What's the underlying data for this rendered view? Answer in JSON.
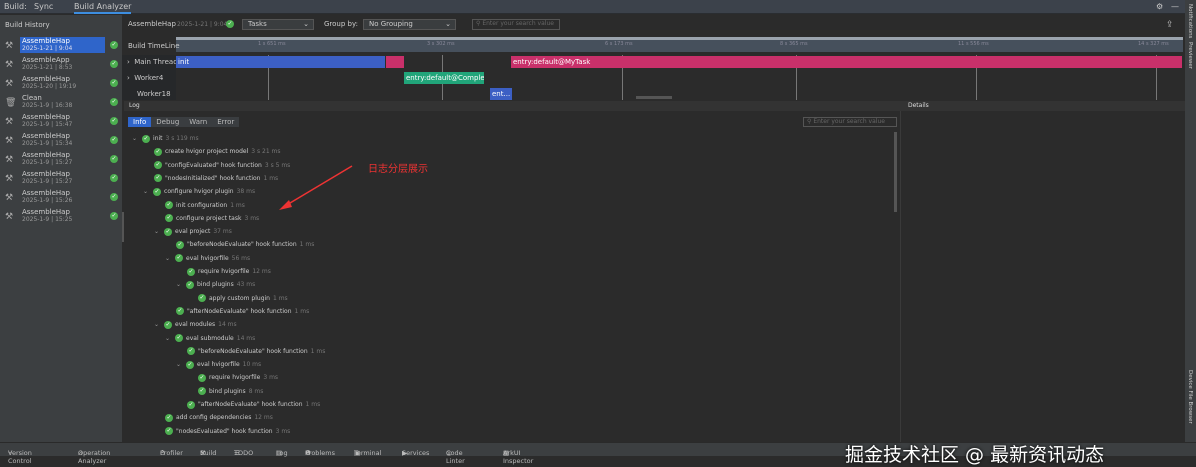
{
  "topbar": {
    "build": "Build:",
    "tabs": [
      "Sync",
      "Build Analyzer"
    ]
  },
  "history": {
    "title": "Build History",
    "items": [
      {
        "name": "AssembleHap",
        "date": "2025-1-21 | 9:04",
        "icon": "hammer-icon"
      },
      {
        "name": "AssembleApp",
        "date": "2025-1-21 | 8:53",
        "icon": "hammer-icon"
      },
      {
        "name": "AssembleHap",
        "date": "2025-1-20 | 19:19",
        "icon": "hammer-icon"
      },
      {
        "name": "Clean",
        "date": "2025-1-9 | 16:38",
        "icon": "trash-icon"
      },
      {
        "name": "AssembleHap",
        "date": "2025-1-9 | 15:47",
        "icon": "hammer-icon"
      },
      {
        "name": "AssembleHap",
        "date": "2025-1-9 | 15:34",
        "icon": "hammer-icon"
      },
      {
        "name": "AssembleHap",
        "date": "2025-1-9 | 15:27",
        "icon": "hammer-icon"
      },
      {
        "name": "AssembleHap",
        "date": "2025-1-9 | 15:27",
        "icon": "hammer-icon"
      },
      {
        "name": "AssembleHap",
        "date": "2025-1-9 | 15:26",
        "icon": "hammer-icon"
      },
      {
        "name": "AssembleHap",
        "date": "2025-1-9 | 15:25",
        "icon": "hammer-icon"
      }
    ]
  },
  "toolbar": {
    "task": "AssembleHap",
    "date": "2025-1-21 | 9:04",
    "view": "Tasks",
    "group_label": "Group by:",
    "group": "No Grouping",
    "search_placeholder": "Enter your search value"
  },
  "timeline": {
    "title": "Build TimeLine",
    "rows": [
      "Main Thread",
      "Worker4",
      "Worker18"
    ],
    "ticks": [
      "1 s 651 ms",
      "3 s 302 ms",
      "6 s 173 ms",
      "8 s 365 ms",
      "11 s 556 ms",
      "14 s 327 ms"
    ],
    "bars": {
      "init": "init",
      "mytask": "entry:default@MyTask",
      "compile": "entry:default@Comple...",
      "ent": "ent..."
    }
  },
  "log": {
    "title": "Log",
    "details": "Details",
    "levels": [
      "Info",
      "Debug",
      "Warn",
      "Error"
    ],
    "search_placeholder": "Enter your search value",
    "rows": [
      {
        "d": 0,
        "c": true,
        "t": "init",
        "tm": "3 s 119 ms"
      },
      {
        "d": 1,
        "c": false,
        "t": "create hvigor project model",
        "tm": "3 s 21 ms"
      },
      {
        "d": 1,
        "c": false,
        "t": "\"configEvaluated\" hook function",
        "tm": "3 s 5 ms"
      },
      {
        "d": 1,
        "c": false,
        "t": "\"nodesInitialized\" hook function",
        "tm": "1 ms"
      },
      {
        "d": 1,
        "c": true,
        "t": "configure hvigor plugin",
        "tm": "38 ms"
      },
      {
        "d": 2,
        "c": false,
        "t": "init configuration",
        "tm": "1 ms"
      },
      {
        "d": 2,
        "c": false,
        "t": "configure project task",
        "tm": "3 ms"
      },
      {
        "d": 2,
        "c": true,
        "t": "eval project",
        "tm": "37 ms"
      },
      {
        "d": 3,
        "c": false,
        "t": "\"beforeNodeEvaluate\" hook function",
        "tm": "1 ms"
      },
      {
        "d": 3,
        "c": true,
        "t": "eval hvigorfile",
        "tm": "56 ms"
      },
      {
        "d": 4,
        "c": false,
        "t": "require hvigorfile",
        "tm": "12 ms"
      },
      {
        "d": 4,
        "c": true,
        "t": "bind plugins",
        "tm": "43 ms"
      },
      {
        "d": 5,
        "c": false,
        "t": "apply custom plugin",
        "tm": "1 ms"
      },
      {
        "d": 3,
        "c": false,
        "t": "\"afterNodeEvaluate\" hook function",
        "tm": "1 ms"
      },
      {
        "d": 2,
        "c": true,
        "t": "eval modules",
        "tm": "14 ms"
      },
      {
        "d": 3,
        "c": true,
        "t": "eval submodule",
        "tm": "14 ms"
      },
      {
        "d": 4,
        "c": false,
        "t": "\"beforeNodeEvaluate\" hook function",
        "tm": "1 ms"
      },
      {
        "d": 4,
        "c": true,
        "t": "eval hvigorfile",
        "tm": "10 ms"
      },
      {
        "d": 5,
        "c": false,
        "t": "require hvigorfile",
        "tm": "3 ms"
      },
      {
        "d": 5,
        "c": false,
        "t": "bind plugins",
        "tm": "8 ms"
      },
      {
        "d": 4,
        "c": false,
        "t": "\"afterNodeEvaluate\" hook function",
        "tm": "1 ms"
      },
      {
        "d": 2,
        "c": false,
        "t": "add config dependencies",
        "tm": "12 ms"
      },
      {
        "d": 2,
        "c": false,
        "t": "\"nodesEvaluated\" hook function",
        "tm": "3 ms"
      }
    ]
  },
  "annotation": "日志分层展示",
  "watermark": "掘金技术社区 @ 最新资讯动态",
  "right_stripe": [
    "Notifications",
    "Previewer",
    "Device File Browser"
  ],
  "bottom": [
    "Version Control",
    "Operation Analyzer",
    "Profiler",
    "Build",
    "TODO",
    "Log",
    "Problems",
    "Terminal",
    "Services",
    "Code Linter",
    "ArkUI Inspector"
  ],
  "colors": {
    "accent": "#2f65ca",
    "success": "#4caf50",
    "task_pink": "#c9306a",
    "task_green": "#21a57a",
    "init_blue": "#3c5fc4"
  }
}
